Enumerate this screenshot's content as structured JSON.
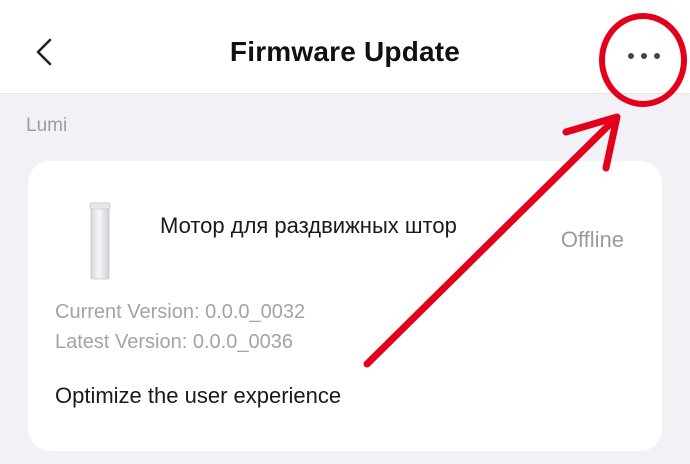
{
  "header": {
    "title": "Firmware Update",
    "back_icon": "chevron-left-icon",
    "more_icon": "more-horizontal-icon"
  },
  "section": {
    "label": "Lumi"
  },
  "device": {
    "name": "Мотор для раздвижных штор",
    "status": "Offline",
    "current_version": "Current Version: 0.0.0_0032",
    "latest_version": "Latest Version: 0.0.0_0036",
    "release_notes": "Optimize the user experience"
  },
  "colors": {
    "background": "#f2f2f6",
    "card": "#ffffff",
    "muted_text": "#9b9ba0",
    "annotation_red": "#e3001b"
  }
}
